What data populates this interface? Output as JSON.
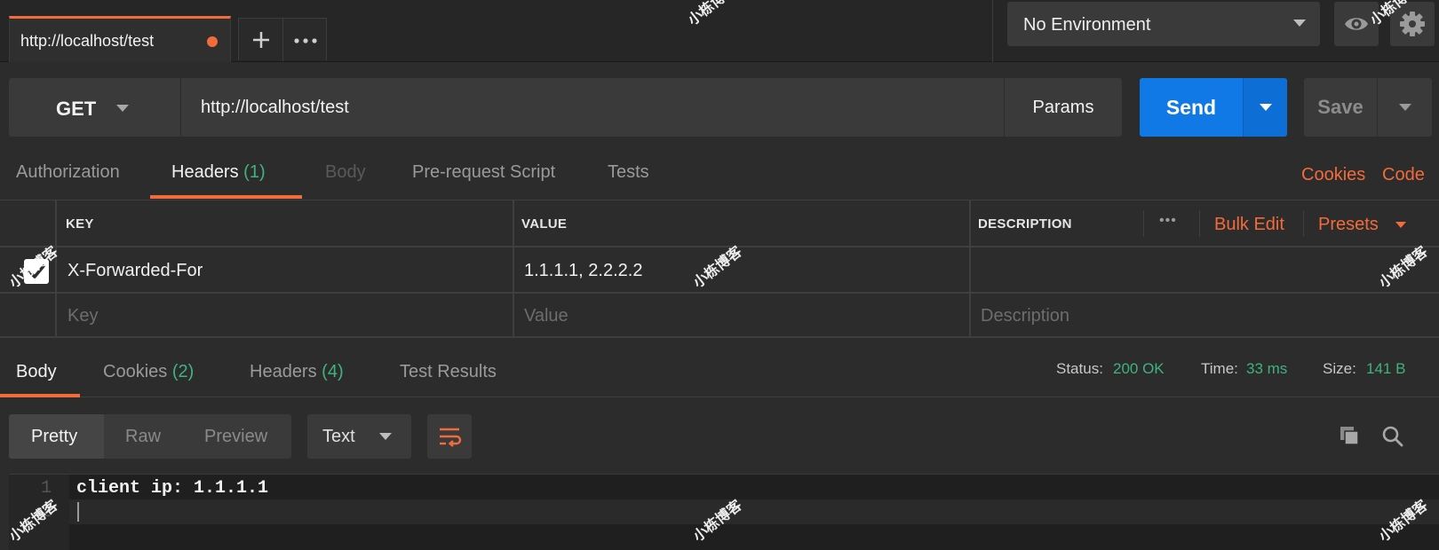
{
  "tab": {
    "title": "http://localhost/test"
  },
  "environment": {
    "selected": "No Environment"
  },
  "request": {
    "method": "GET",
    "url": "http://localhost/test",
    "params_label": "Params",
    "send_label": "Send",
    "save_label": "Save"
  },
  "request_tabs": {
    "authorization": "Authorization",
    "headers": "Headers",
    "headers_count": "(1)",
    "body": "Body",
    "pre_request": "Pre-request Script",
    "tests": "Tests",
    "cookies_link": "Cookies",
    "code_link": "Code"
  },
  "headers_table": {
    "columns": {
      "key": "KEY",
      "value": "VALUE",
      "description": "DESCRIPTION"
    },
    "more": "•••",
    "bulk_edit": "Bulk Edit",
    "presets": "Presets",
    "rows": [
      {
        "checked": true,
        "key": "X-Forwarded-For",
        "value": "1.1.1.1, 2.2.2.2",
        "description": ""
      }
    ],
    "placeholders": {
      "key": "Key",
      "value": "Value",
      "description": "Description"
    }
  },
  "response_tabs": {
    "body": "Body",
    "cookies": "Cookies",
    "cookies_count": "(2)",
    "headers": "Headers",
    "headers_count": "(4)",
    "test_results": "Test Results"
  },
  "response_meta": {
    "status_label": "Status:",
    "status_value": "200 OK",
    "time_label": "Time:",
    "time_value": "33 ms",
    "size_label": "Size:",
    "size_value": "141 B"
  },
  "view": {
    "modes": [
      "Pretty",
      "Raw",
      "Preview"
    ],
    "selected_mode": "Pretty",
    "format": "Text"
  },
  "editor": {
    "line_numbers": [
      "1",
      "2"
    ],
    "lines": [
      "client ip: 1.1.1.1",
      ""
    ]
  },
  "watermark": "小栋博客",
  "colors": {
    "accent_orange": "#f26b3a",
    "send_blue": "#1079e6",
    "success_green": "#3fb37f",
    "background": "#2c2c2c"
  },
  "icons": [
    "plus-icon",
    "more-icon",
    "eye-icon",
    "gear-icon",
    "wrap-lines-icon",
    "copy-icon",
    "search-icon",
    "checkmark-icon"
  ]
}
